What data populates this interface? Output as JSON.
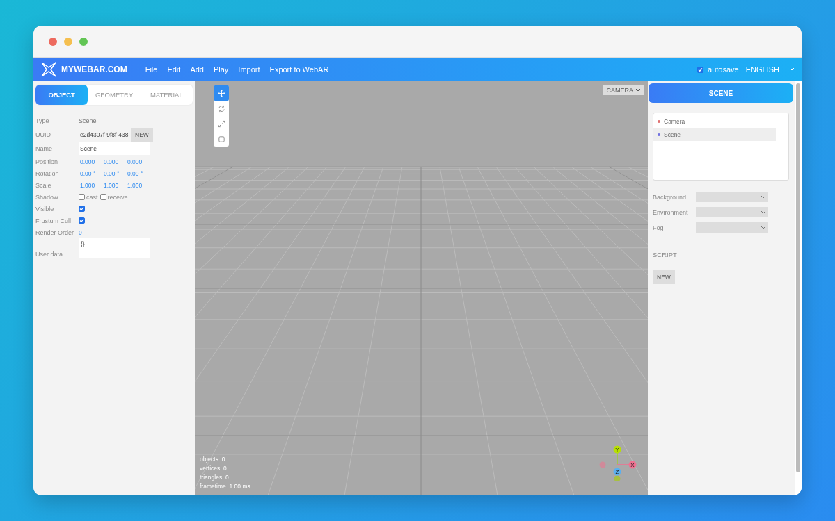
{
  "menubar": {
    "logo": "MYWEBAR.COM",
    "menus": [
      "File",
      "Edit",
      "Add",
      "Play",
      "Import",
      "Export to WebAR"
    ],
    "autosave": {
      "label": "autosave",
      "checked": true
    },
    "language": "ENGLISH"
  },
  "sidebar": {
    "tabs": [
      {
        "label": "OBJECT",
        "selected": true
      },
      {
        "label": "GEOMETRY",
        "selected": false
      },
      {
        "label": "MATERIAL",
        "selected": false
      }
    ],
    "properties": [
      {
        "kind": "text",
        "label": "Type",
        "value": "Scene"
      },
      {
        "kind": "uuid",
        "label": "UUID",
        "value": "e2d4307f-9f8f-438",
        "button": "NEW"
      },
      {
        "kind": "input",
        "label": "Name",
        "value": "Scene"
      },
      {
        "kind": "vector",
        "label": "Position",
        "values": [
          "0.000",
          "0.000",
          "0.000"
        ]
      },
      {
        "kind": "vector",
        "label": "Rotation",
        "values": [
          "0.00 °",
          "0.00 °",
          "0.00 °"
        ]
      },
      {
        "kind": "vector",
        "label": "Scale",
        "values": [
          "1.000",
          "1.000",
          "1.000"
        ]
      },
      {
        "kind": "checks",
        "label": "Shadow",
        "options": [
          {
            "label": "cast",
            "checked": false
          },
          {
            "label": "receive",
            "checked": false
          }
        ]
      },
      {
        "kind": "check",
        "label": "Visible",
        "checked": true
      },
      {
        "kind": "check",
        "label": "Frustum Cull",
        "checked": true
      },
      {
        "kind": "number",
        "label": "Render Order",
        "value": "0"
      },
      {
        "kind": "textarea",
        "label": "User data",
        "value": "{}"
      }
    ]
  },
  "viewport": {
    "camera": "CAMERA",
    "tools": [
      {
        "kind": "move",
        "selected": true
      },
      {
        "kind": "rotate",
        "selected": false
      },
      {
        "kind": "scale",
        "selected": false
      },
      {
        "kind": "box",
        "selected": false
      }
    ],
    "stats": [
      {
        "label": "objects",
        "value": "0"
      },
      {
        "label": "vertices",
        "value": "0"
      },
      {
        "label": "triangles",
        "value": "0"
      },
      {
        "label": "frametime",
        "value": "1.00 ms"
      }
    ],
    "gizmo": [
      "Y",
      "X",
      "Z"
    ]
  },
  "panel": {
    "title": "SCENE",
    "outliner": [
      {
        "label": "Camera",
        "color": "#e07070",
        "selected": false
      },
      {
        "label": "Scene",
        "color": "#7070e0",
        "selected": true
      }
    ],
    "selects": [
      {
        "label": "Background"
      },
      {
        "label": "Environment"
      },
      {
        "label": "Fog"
      }
    ],
    "script": {
      "heading": "SCRIPT",
      "button": "NEW"
    }
  }
}
